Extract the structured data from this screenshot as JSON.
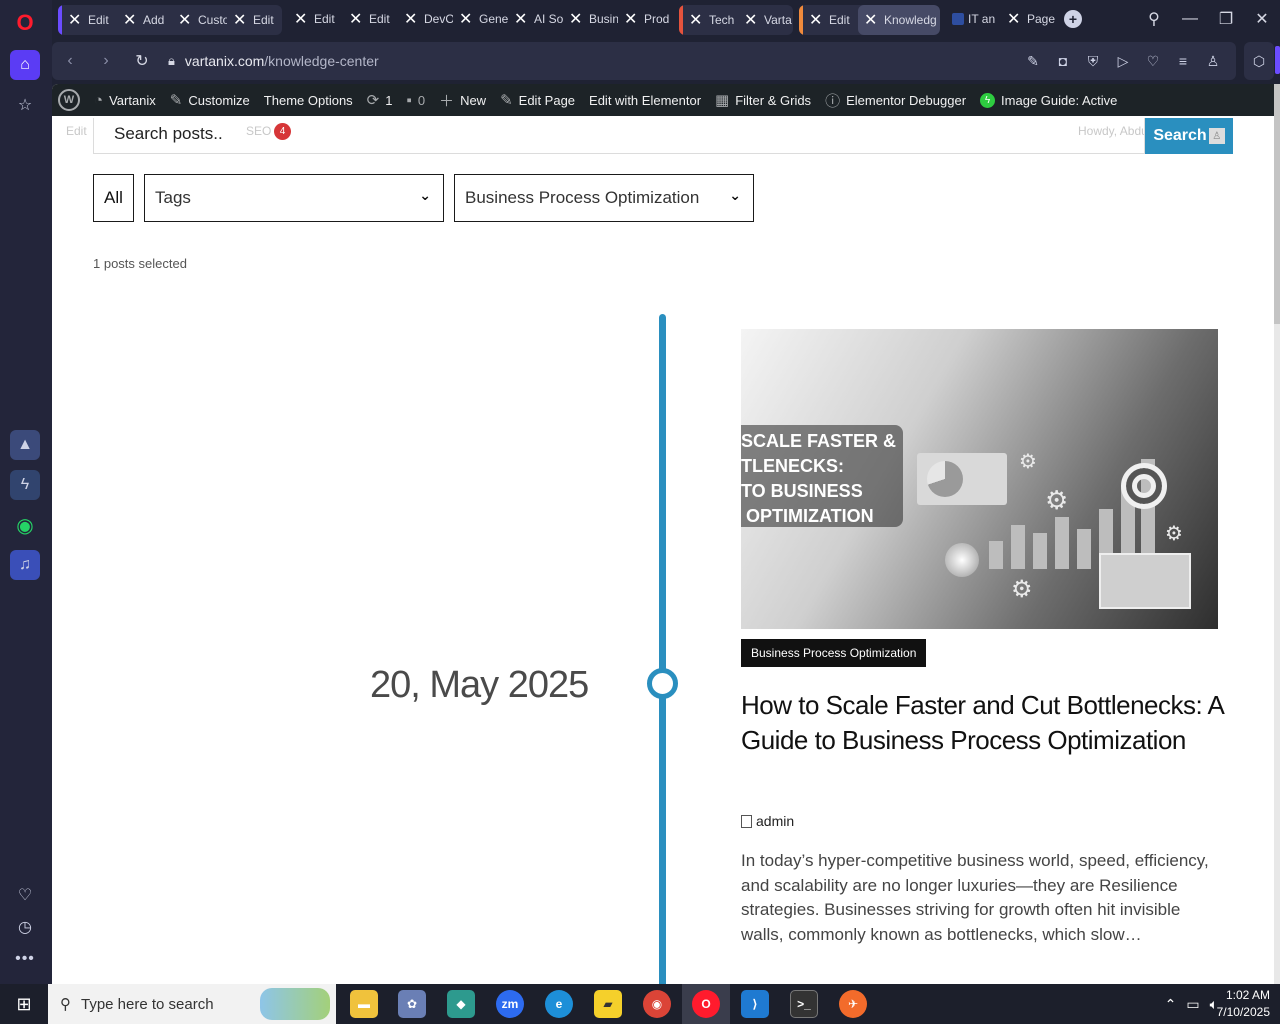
{
  "browser": {
    "tabs": [
      {
        "label": "Edit"
      },
      {
        "label": "Add"
      },
      {
        "label": "Custo"
      },
      {
        "label": "Edit"
      },
      {
        "label": "Edit"
      },
      {
        "label": "Edit"
      },
      {
        "label": "DevO"
      },
      {
        "label": "Gene"
      },
      {
        "label": "AI So"
      },
      {
        "label": "Busin"
      },
      {
        "label": "Prod"
      },
      {
        "label": "Tech"
      },
      {
        "label": "Varta"
      },
      {
        "label": "Edit"
      },
      {
        "label": "Knowledg"
      },
      {
        "label": "IT an"
      },
      {
        "label": "Page"
      }
    ],
    "group_colors": [
      "#6b4cff",
      "#e5533d",
      "#f08a3c"
    ],
    "url_domain": "vartanix.com",
    "url_path": "/knowledge-center"
  },
  "admin_bar": {
    "site": "Vartanix",
    "customize": "Customize",
    "theme_options": "Theme Options",
    "updates": "1",
    "comments": "0",
    "new": "New",
    "edit_page": "Edit Page",
    "edit_elementor": "Edit with Elementor",
    "filter_grids": "Filter & Grids",
    "debugger": "Elementor Debugger",
    "image_guide": "Image Guide: Active"
  },
  "ghost_bar": {
    "left": "Edit",
    "seo": "SEO",
    "seo_count": "4",
    "howdy": "Howdy, Abdul Saboor"
  },
  "search": {
    "placeholder": "Search posts..",
    "button": "Search"
  },
  "filters": {
    "all": "All",
    "tags": "Tags",
    "category": "Business Process Optimization"
  },
  "selected_count": "1 posts selected",
  "post": {
    "date": "20, May 2025",
    "image_text": "SCALE FASTER &\nTLENECKS:\nTO BUSINESS\n OPTIMIZATION",
    "category": "Business Process Optimization",
    "title": "How to Scale Faster and Cut Bottlenecks: A Guide to Business Process Optimization",
    "author": "admin",
    "excerpt": "In today’s hyper-competitive business world, speed, efficiency, and scalability are no longer luxuries—they are Resilience strategies. Businesses striving for growth often hit invisible walls, commonly known as bottlenecks, which slow…"
  },
  "taskbar": {
    "search_placeholder": "Type here to search",
    "time": "1:02 AM",
    "date": "7/10/2025",
    "zoom_label": "zm"
  },
  "accent_color": "#2a8fbf"
}
